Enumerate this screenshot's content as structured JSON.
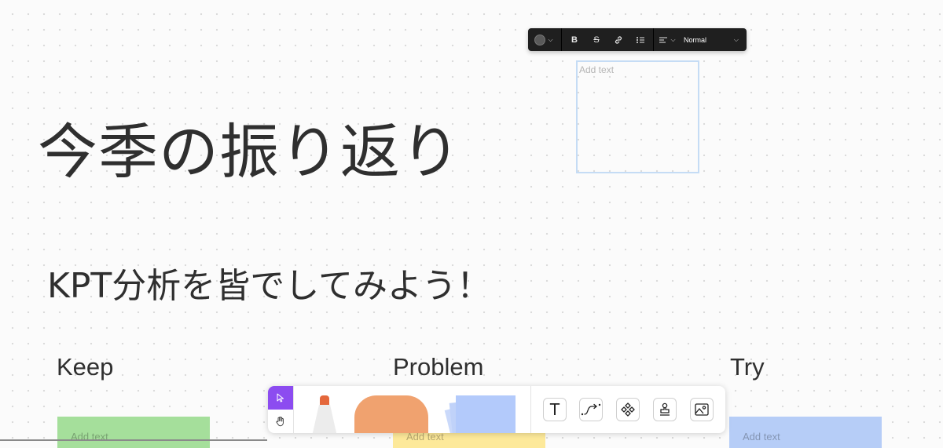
{
  "canvas": {
    "title": "今季の振り返り",
    "subtitle": "KPT分析を皆でしてみよう！",
    "columns": [
      {
        "label": "Keep",
        "sticky_placeholder": "Add text",
        "sticky_color": "#a5df9b"
      },
      {
        "label": "Problem",
        "sticky_placeholder": "Add text",
        "sticky_color": "#fde99a"
      },
      {
        "label": "Try",
        "sticky_placeholder": "Add text",
        "sticky_color": "#b6cdf7"
      }
    ]
  },
  "text_toolbar": {
    "color_icon": "color-dot-icon",
    "bold_label": "B",
    "strike_label": "S",
    "link_icon": "link-icon",
    "list_icon": "bullet-list-icon",
    "align_icon": "align-left-icon",
    "style_value": "Normal",
    "dropdown_icon": "chevron-down-icon"
  },
  "selected_textbox": {
    "placeholder": "Add text"
  },
  "dock": {
    "mode_tools": [
      "pointer-icon",
      "hand-icon"
    ],
    "accent_color": "#8c4cf0",
    "creation_tools": [
      "marker-tool",
      "shape-tool",
      "sticky-note-tool"
    ],
    "tools": [
      {
        "name": "text-tool",
        "glyph": "T"
      },
      {
        "name": "connector-tool"
      },
      {
        "name": "component-tool"
      },
      {
        "name": "stamp-tool"
      },
      {
        "name": "image-tool"
      }
    ],
    "marker_color": "#e4673b",
    "shape_color": "#f0a26f",
    "sticky_stack_color": "#b3cafb"
  }
}
